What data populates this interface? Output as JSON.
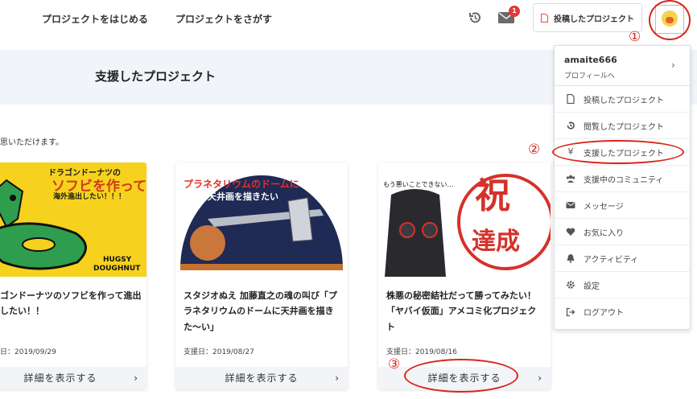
{
  "nav": {
    "start_project": "プロジェクトをはじめる",
    "find_project": "プロジェクトをさがす",
    "mail_badge": "1",
    "post_button": "投稿したプロジェクト"
  },
  "page": {
    "title": "支援したプロジェクト",
    "intro": "思いただけます。"
  },
  "cards": [
    {
      "title": "ゴンドーナツのソフビを作って進出したい！！",
      "date": "日：2019/09/29",
      "detail": "詳細を表示する",
      "image": {
        "line1": "ドラゴンドーナツの",
        "line2": "ソフビを作って",
        "line3": "海外進出したい！！！",
        "brand1": "HUGSY",
        "brand2": "DOUGHNUT"
      }
    },
    {
      "title": "スタジオぬえ 加藤直之の魂の叫び「プラネタリウムのドームに天井画を描きた〜い」",
      "date": "支援日：2019/08/27",
      "detail": "詳細を表示する",
      "image": {
        "line1": "プラネタリウムのドームに",
        "line2": "天井画を描きたい"
      }
    },
    {
      "title": "株悪の秘密結社だって勝ってみたい！「ヤバイ仮面」アメコミ化プロジェクト",
      "date": "支援日：2019/08/16",
      "detail": "詳細を表示する",
      "image": {
        "caption": "もう悪いことできない…",
        "stamp1": "祝",
        "stamp2": "達成"
      }
    }
  ],
  "menu": {
    "username": "amaite666",
    "profile_link": "プロフィールへ",
    "items": [
      {
        "label": "投稿したプロジェクト",
        "icon": "document-icon"
      },
      {
        "label": "閲覧したプロジェクト",
        "icon": "history-icon"
      },
      {
        "label": "支援したプロジェクト",
        "icon": "yen-icon"
      },
      {
        "label": "支援中のコミュニティ",
        "icon": "people-icon"
      },
      {
        "label": "メッセージ",
        "icon": "envelope-icon"
      },
      {
        "label": "お気に入り",
        "icon": "heart-icon"
      },
      {
        "label": "アクティビティ",
        "icon": "bell-icon"
      },
      {
        "label": "設定",
        "icon": "gear-icon"
      },
      {
        "label": "ログアウト",
        "icon": "logout-icon"
      }
    ]
  },
  "annotations": {
    "n1": "①",
    "n2": "②",
    "n3": "③",
    "color": "#d8251c"
  },
  "colors": {
    "banner_bg": "#f1f4f8",
    "badge": "#e53935",
    "detail_bg": "#f2f4f7"
  }
}
